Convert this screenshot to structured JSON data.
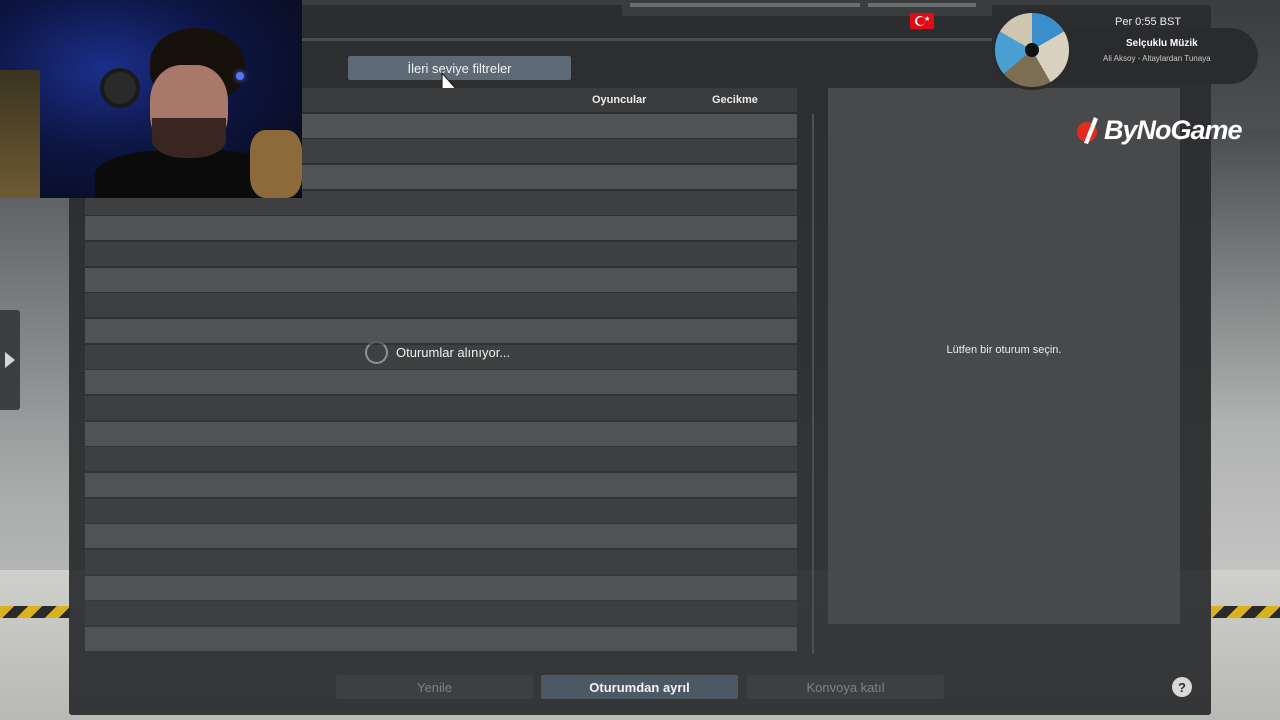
{
  "toolbar": {
    "advanced_filters_label": "İleri seviye filtreler"
  },
  "server_list": {
    "columns": {
      "players": "Oyuncular",
      "latency": "Gecikme"
    },
    "loading_text": "Oturumlar alınıyor..."
  },
  "detail_panel": {
    "placeholder": "Lütfen bir oturum seçin."
  },
  "actions": {
    "refresh_label": "Yenile",
    "leave_label": "Oturumdan ayrıl",
    "join_convoy_label": "Konvoya katıl",
    "help_label": "?"
  },
  "overlay": {
    "music": {
      "time": "Per 0:55 BST",
      "title": "Selçuklu Müzik",
      "artist": "Ali Aksoy - Altaylardan Tunaya"
    },
    "logo_text": "ByNoGame"
  },
  "icons": {
    "flag": "turkey-flag-icon",
    "help": "help-icon",
    "spinner": "loading-spinner-icon",
    "side_arrow": "chevron-right-icon",
    "cursor": "mouse-cursor-icon"
  },
  "colors": {
    "dialog_bg": "#2b2c2e",
    "row_light": "#505254",
    "row_dark": "#3d3f41",
    "accent_button": "#4c5864",
    "filter_button": "#5d6a75",
    "flag_red": "#e30a17",
    "logo_red": "#e32b1f"
  }
}
